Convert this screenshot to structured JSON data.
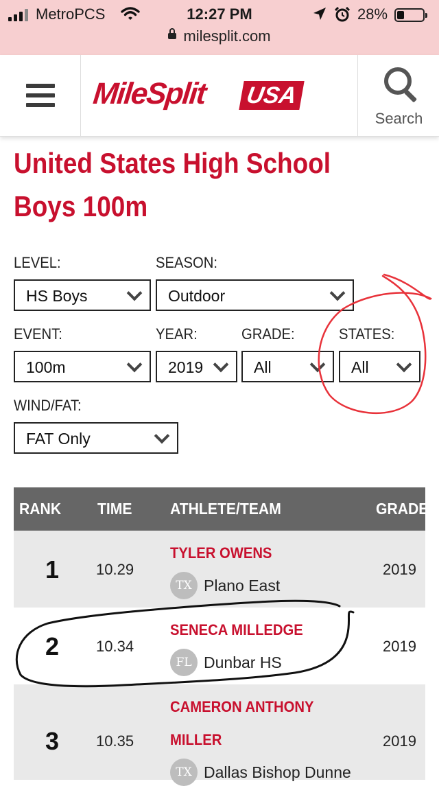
{
  "status_bar": {
    "carrier": "MetroPCS",
    "time": "12:27 PM",
    "battery": "28%",
    "battery_level": 0.28,
    "url": "milesplit.com"
  },
  "header": {
    "logo_text": "MileSplit",
    "logo_badge": "USA",
    "search_label": "Search"
  },
  "page": {
    "title": "United States High School Boys 100m"
  },
  "filters": {
    "level": {
      "label": "LEVEL:",
      "value": "HS Boys"
    },
    "season": {
      "label": "SEASON:",
      "value": "Outdoor"
    },
    "event": {
      "label": "EVENT:",
      "value": "100m"
    },
    "year": {
      "label": "YEAR:",
      "value": "2019"
    },
    "grade": {
      "label": "GRADE:",
      "value": "All"
    },
    "states": {
      "label": "STATES:",
      "value": "All"
    },
    "wind": {
      "label": "WIND/FAT:",
      "value": "FAT Only"
    }
  },
  "table": {
    "headers": {
      "rank": "RANK",
      "time": "TIME",
      "athlete": "ATHLETE/TEAM",
      "grade": "GRADE"
    },
    "rows": [
      {
        "rank": "1",
        "time": "10.29",
        "athlete": "TYLER OWENS",
        "state": "TX",
        "team": "Plano East",
        "grade": "2019"
      },
      {
        "rank": "2",
        "time": "10.34",
        "athlete": "SENECA MILLEDGE",
        "state": "FL",
        "team": "Dunbar HS",
        "grade": "2019"
      },
      {
        "rank": "3",
        "time": "10.35",
        "athlete_line1": "CAMERON ANTHONY",
        "athlete_line2": "MILLER",
        "state": "TX",
        "team": "Dallas Bishop Dunne",
        "grade": "2019"
      }
    ]
  },
  "colors": {
    "brand_red": "#c8102e",
    "status_bar_bg": "#f7cfd0",
    "table_header_bg": "#666666",
    "row_alt_bg": "#e9e9e9"
  }
}
